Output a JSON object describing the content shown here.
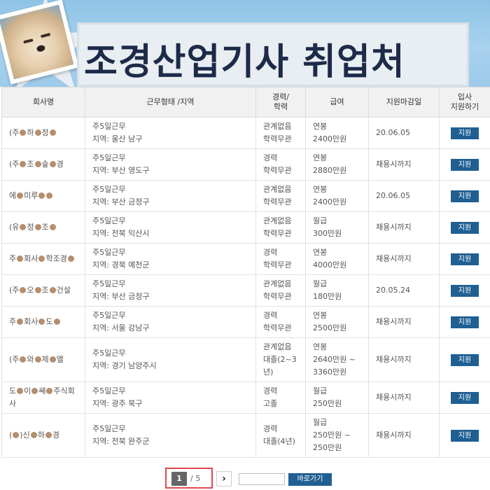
{
  "banner": {
    "title": "조경산업기사 취업처"
  },
  "table": {
    "headers": [
      "회사명",
      "근무형태 /지역",
      "경력/\n학력",
      "급여",
      "지원마감일",
      "입사\n지원하기"
    ],
    "rows": [
      {
        "company_a": "(주",
        "company_b": "하",
        "company_c": "정",
        "company_d": "",
        "work_type": "주5일근무",
        "region": "지역: 울산 남구",
        "career": "관계없음",
        "education": "학력무관",
        "pay_type": "연봉",
        "pay_amount": "2400만원",
        "deadline": "20.06.05",
        "apply": "지원"
      },
      {
        "company_a": "(주",
        "company_b": "조",
        "company_c": "숲",
        "company_d": "경",
        "work_type": "주5일근무",
        "region": "지역: 부산 영도구",
        "career": "경력",
        "education": "학력무관",
        "pay_type": "연봉",
        "pay_amount": "2880만원",
        "deadline": "채용시까지",
        "apply": "지원"
      },
      {
        "company_a": "에",
        "company_b": "미루",
        "company_c": "",
        "company_d": "",
        "work_type": "주5일근무",
        "region": "지역: 부산 금정구",
        "career": "관계없음",
        "education": "학력무관",
        "pay_type": "연봉",
        "pay_amount": "2400만원",
        "deadline": "20.06.05",
        "apply": "지원"
      },
      {
        "company_a": "(유",
        "company_b": "정",
        "company_c": "조",
        "company_d": "",
        "work_type": "주5일근무",
        "region": "지역: 전북 익산시",
        "career": "관계없음",
        "education": "학력무관",
        "pay_type": "월급",
        "pay_amount": "300만원",
        "deadline": "채용시까지",
        "apply": "지원"
      },
      {
        "company_a": "주",
        "company_b": "회사",
        "company_c": "학조경",
        "company_d": "",
        "work_type": "주5일근무",
        "region": "지역: 경북 예천군",
        "career": "경력",
        "education": "학력무관",
        "pay_type": "연봉",
        "pay_amount": "4000만원",
        "deadline": "채용시까지",
        "apply": "지원"
      },
      {
        "company_a": "(주",
        "company_b": "오",
        "company_c": "조",
        "company_d": "건설",
        "work_type": "주5일근무",
        "region": "지역: 부산 금정구",
        "career": "관계없음",
        "education": "학력무관",
        "pay_type": "월급",
        "pay_amount": "180만원",
        "deadline": "20.05.24",
        "apply": "지원"
      },
      {
        "company_a": "주",
        "company_b": "회사",
        "company_c": "도",
        "company_d": "",
        "work_type": "주5일근무",
        "region": "지역: 서울 강남구",
        "career": "경력",
        "education": "학력무관",
        "pay_type": "연봉",
        "pay_amount": "2500만원",
        "deadline": "채용시까지",
        "apply": "지원"
      },
      {
        "company_a": "(주",
        "company_b": "와",
        "company_c": "제",
        "company_d": "앨",
        "work_type": "주5일근무",
        "region": "지역: 경기 남양주시",
        "career": "관계없음",
        "education": "대졸(2~3년)",
        "pay_type": "연봉",
        "pay_amount": "2640만원 ~ 3360만원",
        "deadline": "채용시까지",
        "apply": "지원"
      },
      {
        "company_a": "도",
        "company_b": "이",
        "company_c": "쌔",
        "company_d": "주식회사",
        "work_type": "주5일근무",
        "region": "지역: 광주 북구",
        "career": "경력",
        "education": "고졸",
        "pay_type": "월급",
        "pay_amount": "250만원",
        "deadline": "채용시까지",
        "apply": "지원"
      },
      {
        "company_a": "(",
        "company_b": ")신",
        "company_c": "하",
        "company_d": "경",
        "work_type": "주5일근무",
        "region": "지역: 전북 완주군",
        "career": "경력",
        "education": "대졸(4년)",
        "pay_type": "월급",
        "pay_amount": "250만원 ~ 250만원",
        "deadline": "채용시까지",
        "apply": "지원"
      }
    ]
  },
  "pagination": {
    "current": "1",
    "total": "/ 5",
    "next": "›",
    "input_value": "",
    "go_label": "바로가기"
  },
  "colors": {
    "header_bg": "#f1f1f1",
    "button": "#1f5f92",
    "title": "#1d2b49",
    "highlight": "#e0464f"
  }
}
